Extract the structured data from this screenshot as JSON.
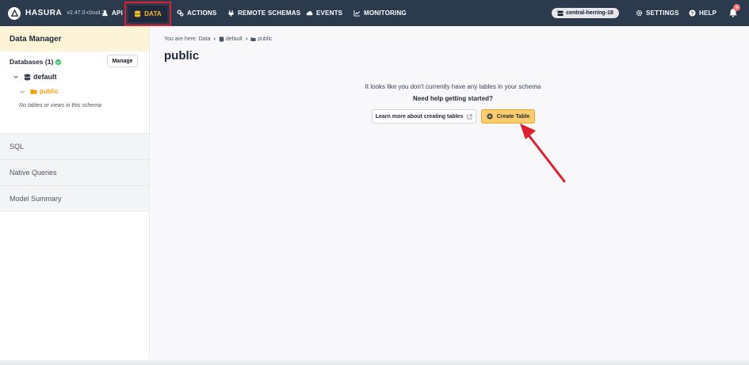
{
  "topnav": {
    "brand": "HASURA",
    "version": "v2.47.0-cloud.2",
    "items": {
      "api": "API",
      "data": "DATA",
      "actions": "ACTIONS",
      "remote_schemas": "REMOTE SCHEMAS",
      "events": "EVENTS",
      "monitoring": "MONITORING",
      "settings": "SETTINGS",
      "help": "HELP"
    },
    "project": "central-herring-18",
    "notification_count": "9"
  },
  "sidebar": {
    "header": "Data Manager",
    "databases_label": "Databases (1)",
    "manage_label": "Manage",
    "database": "default",
    "schema": "public",
    "empty_note": "No tables or views in this schema",
    "sections": [
      "SQL",
      "Native Queries",
      "Model Summary"
    ]
  },
  "main": {
    "breadcrumb": {
      "prefix": "You are here: Data",
      "database": "default",
      "schema": "public"
    },
    "title": "public",
    "empty_message": "It looks like you don't currently have any tables in your schema",
    "help_message": "Need help getting started?",
    "learn_button": "Learn more about creating tables",
    "create_button": "Create Table"
  },
  "colors": {
    "nav_bg": "#2c3a4d",
    "highlight_box": "#e11d2e",
    "accent_yellow": "#facc6b",
    "annotation_arrow": "#e11d2e"
  }
}
